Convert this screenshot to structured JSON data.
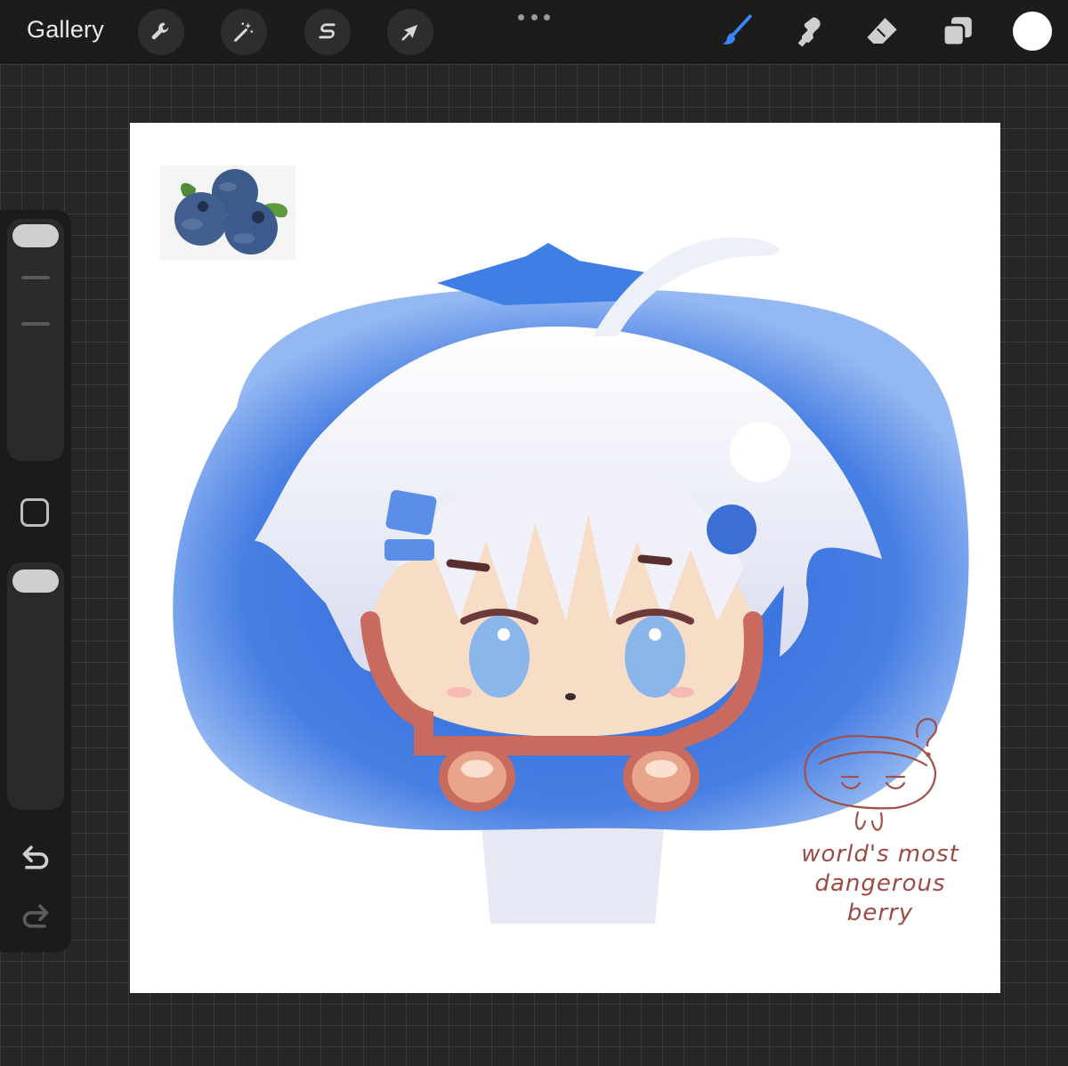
{
  "toolbar": {
    "gallery_label": "Gallery",
    "left_tools": [
      {
        "name": "actions",
        "icon": "wrench-icon"
      },
      {
        "name": "adjustments",
        "icon": "magic-wand-icon"
      },
      {
        "name": "selection",
        "icon": "selection-s-icon"
      },
      {
        "name": "transform",
        "icon": "arrow-cursor-icon"
      }
    ],
    "more_icon": "ellipsis-icon",
    "right_tools": [
      {
        "name": "brush",
        "icon": "brush-icon",
        "active": true,
        "color": "#3a86ff"
      },
      {
        "name": "smudge",
        "icon": "smudge-finger-icon",
        "active": false
      },
      {
        "name": "eraser",
        "icon": "eraser-icon",
        "active": false
      },
      {
        "name": "layers",
        "icon": "layers-icon",
        "active": false
      }
    ],
    "current_color": "#ffffff"
  },
  "sidebar": {
    "brush_size_slider": {
      "icon": "size-slider"
    },
    "modify_button_icon": "square-icon",
    "opacity_slider": {
      "icon": "opacity-slider"
    },
    "undo_icon": "undo-icon",
    "redo_icon": "redo-icon"
  },
  "canvas": {
    "background": "#ffffff",
    "reference_image": "blueberries-photo",
    "artwork": "chibi-blueberry-character",
    "caption_lines": [
      "world's most",
      "dangerous",
      "berry"
    ],
    "caption_color": "#9c4a44",
    "accent_colors": {
      "berry_blue": "#4a80e6",
      "hair_white": "#eef0f8",
      "skin": "#f7dcc6",
      "outline": "#c96a5e"
    }
  }
}
